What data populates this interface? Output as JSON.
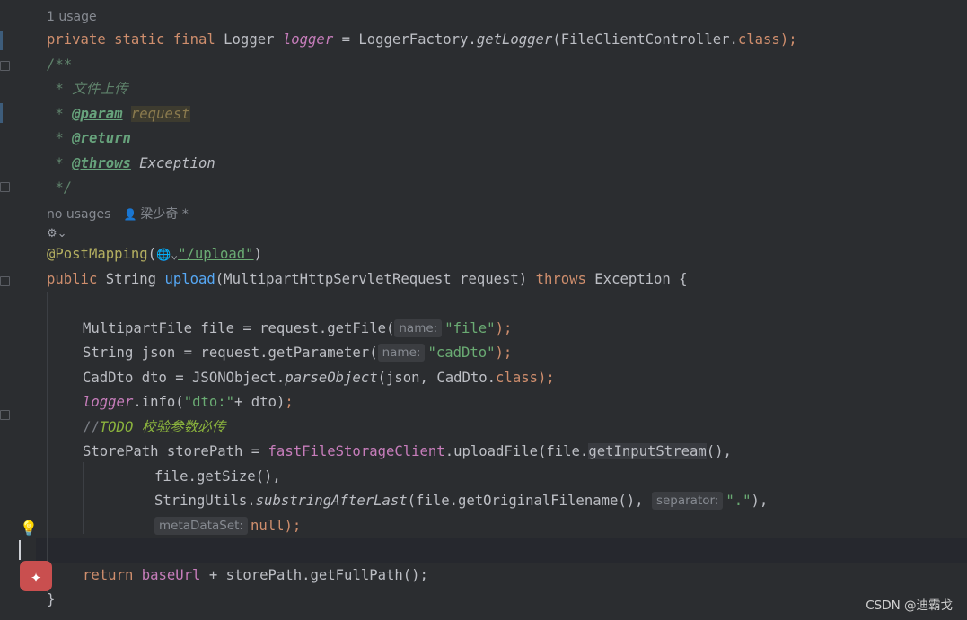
{
  "hints": {
    "usage_top": "1 usage",
    "usage_upload": "no usages",
    "author": "梁少奇 *"
  },
  "code": {
    "l1_private": "private static final",
    "l1_type": " Logger ",
    "l1_field": "logger",
    "l1_eq": " = LoggerFactory.",
    "l1_method": "getLogger",
    "l1_arg": "(FileClientController.",
    "l1_class": "class",
    "l1_end": ");",
    "doc_open": "/**",
    "doc_desc": " * 文件上传",
    "doc_star": " * ",
    "doc_param_tag": "@param",
    "doc_param_name": "request",
    "doc_return_tag": "@return",
    "doc_throws_tag": "@throws",
    "doc_throws_type": " Exception",
    "doc_close": " */",
    "mapping_ann": "@PostMapping",
    "mapping_open": "(",
    "mapping_path": "\"/upload\"",
    "mapping_close": ")",
    "sig_public": "public",
    "sig_type": " String ",
    "sig_name": "upload",
    "sig_params": "(MultipartHttpServletRequest request) ",
    "sig_throws": "throws",
    "sig_rest": " Exception {",
    "s1_a": "MultipartFile file = request.getFile(",
    "s1_hint": "name:",
    "s1_str": "\"file\"",
    "s1_end": ");",
    "s2_a": "String json = request.getParameter(",
    "s2_hint": "name:",
    "s2_str": "\"cadDto\"",
    "s2_end": ");",
    "s3_a": "CadDto dto = JSONObject.",
    "s3_m": "parseObject",
    "s3_b": "(json, CadDto.",
    "s3_class": "class",
    "s3_end": ");",
    "s4_field": "logger",
    "s4_a": ".info(",
    "s4_str": "\"dto:\"",
    "s4_b": "+ dto)",
    "s4_end": ";",
    "s5_slash": "//",
    "s5_todo": "TODO 校验参数必传",
    "s6_a": "StorePath storePath = ",
    "s6_field": "fastFileStorageClient",
    "s6_b": ".uploadFile(file.",
    "s6_hl": "getInputStream",
    "s6_c": "(),",
    "s7_a": "file.getSize(),",
    "s8_a": "StringUtils.",
    "s8_m": "substringAfterLast",
    "s8_b": "(file.getOriginalFilename(), ",
    "s8_hint": "separator:",
    "s8_str": "\".\"",
    "s8_end": "),",
    "s9_hint": "metaDataSet:",
    "s9_null": "null",
    "s9_end": ");",
    "ret_kw": "return",
    "ret_field": " baseUrl",
    "ret_rest": " + storePath.getFullPath();",
    "close_brace": "}"
  },
  "watermark": "CSDN @迪霸戈",
  "colors": {
    "background": "#2b2d30",
    "keyword": "#cf8e6d",
    "field": "#c77dbb",
    "string": "#6aab73",
    "method": "#56a8f5",
    "annotation": "#b3ae60",
    "doc": "#5f826b"
  },
  "icons": {
    "usage_person": "person-icon",
    "web_endpoint": "globe-icon",
    "bean": "bean-icon",
    "intention": "lightbulb-icon",
    "ai_assist": "magic-wand-icon"
  }
}
